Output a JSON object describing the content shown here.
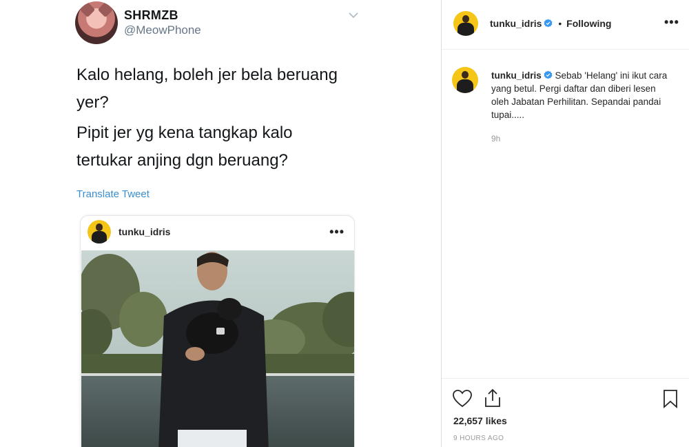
{
  "tweet": {
    "display_name": "SHRMZB",
    "handle": "@MeowPhone",
    "text_line1": "Kalo helang, boleh jer bela beruang yer?",
    "text_line2": "Pipit jer yg kena tangkap kalo tertukar anjing dgn beruang?",
    "translate_label": "Translate Tweet",
    "chevron_icon": "chevron-down-icon",
    "embedded_post": {
      "username": "tunku_idris",
      "more_label": "•••"
    }
  },
  "instagram": {
    "header": {
      "username": "tunku_idris",
      "dot": "•",
      "follow_status": "Following",
      "more_label": "•••",
      "verified_icon": "verified-badge-icon"
    },
    "caption": {
      "username": "tunku_idris",
      "text": "Sebab 'Helang' ini ikut cara yang betul. Pergi daftar dan diberi lesen oleh Jabatan Perhilitan. Sepandai pandai tupai.....",
      "time": "9h"
    },
    "actions": {
      "like_icon": "heart-icon",
      "share_icon": "share-icon",
      "save_icon": "bookmark-icon"
    },
    "likes": "22,657 likes",
    "posted_ago": "9 HOURS AGO"
  },
  "colors": {
    "link_blue": "#3a8fd1",
    "verified_blue": "#3897f0",
    "avatar_yellow": "#f5c518",
    "text_dark": "#262626",
    "text_muted": "#999999"
  }
}
